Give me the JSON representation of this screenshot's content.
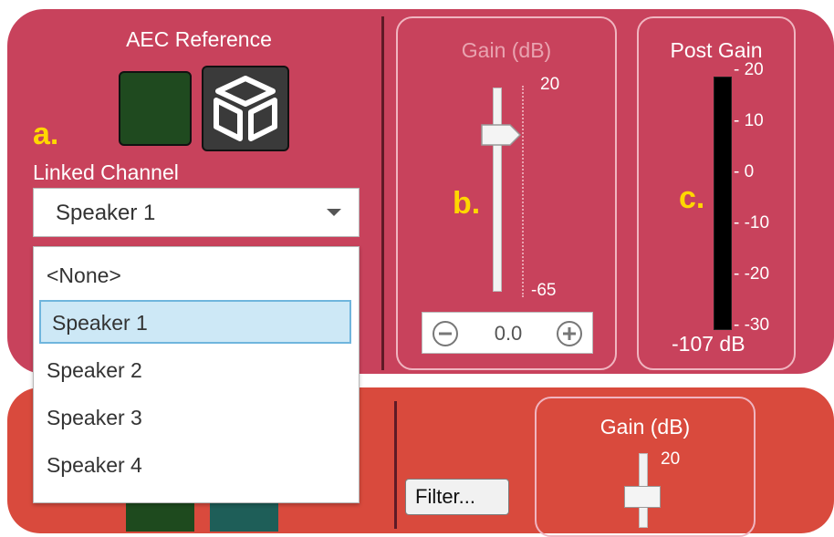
{
  "aec": {
    "title": "AEC Reference",
    "label_a": "a.",
    "linked_label": "Linked Channel",
    "selected": "Speaker 1",
    "icons": [
      "green-square-icon",
      "cube-icon"
    ]
  },
  "dropdown_list": {
    "options": [
      "<None>",
      "Speaker 1",
      "Speaker 2",
      "Speaker 3",
      "Speaker 4"
    ],
    "highlighted_index": 1
  },
  "gain": {
    "title": "Gain  (dB)",
    "max_label": "20",
    "min_label": "-65",
    "label_b": "b.",
    "value": "0.0",
    "minus_icon": "minus-circle-icon",
    "plus_icon": "plus-circle-icon"
  },
  "post_gain": {
    "title": "Post Gain",
    "ticks": [
      "- 20",
      "- 10",
      "- 0",
      "- -10",
      "- -20",
      "- -30"
    ],
    "label_c": "c.",
    "readout": "-107 dB"
  },
  "bottom": {
    "filter_label": "Filter...",
    "gain_title": "Gain  (dB)",
    "gain_max": "20"
  },
  "colors": {
    "top_panel": "#c8425c",
    "bottom_panel": "#d94a3d",
    "label_yellow": "#ffd700",
    "selection": "#cde8f6"
  }
}
